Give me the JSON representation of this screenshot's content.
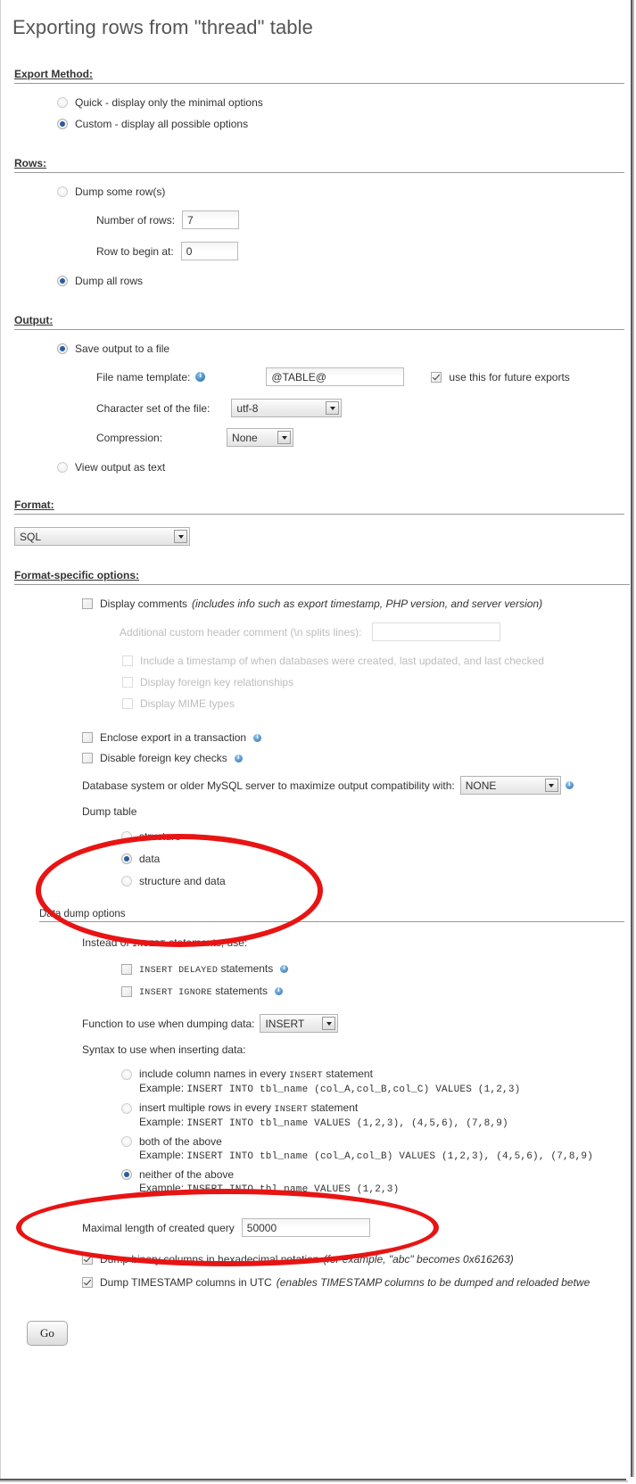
{
  "page_title": "Exporting rows from \"thread\" table",
  "export_method": {
    "legend": "Export Method:",
    "options": [
      {
        "label": "Quick - display only the minimal options",
        "checked": false
      },
      {
        "label": "Custom - display all possible options",
        "checked": true
      }
    ]
  },
  "rows": {
    "legend": "Rows:",
    "dump_some_label": "Dump some row(s)",
    "dump_some_checked": false,
    "number_of_rows_label": "Number of rows:",
    "number_of_rows_value": "7",
    "row_to_begin_label": "Row to begin at:",
    "row_to_begin_value": "0",
    "dump_all_label": "Dump all rows",
    "dump_all_checked": true
  },
  "output": {
    "legend": "Output:",
    "save_to_file_label": "Save output to a file",
    "save_to_file_checked": true,
    "file_name_template_label": "File name template:",
    "file_name_template_value": "@TABLE@",
    "use_future_exports_label": "use this for future exports",
    "use_future_exports_checked": true,
    "charset_label": "Character set of the file:",
    "charset_value": "utf-8",
    "compression_label": "Compression:",
    "compression_value": "None",
    "view_as_text_label": "View output as text",
    "view_as_text_checked": false
  },
  "format": {
    "legend": "Format:",
    "value": "SQL"
  },
  "format_specific": {
    "legend": "Format-specific options:",
    "display_comments_label": "Display comments",
    "display_comments_note": "(includes info such as export timestamp, PHP version, and server version)",
    "display_comments_checked": false,
    "custom_header_label": "Additional custom header comment (\\n splits lines):",
    "custom_header_value": "",
    "sub_options": [
      {
        "label": "Include a timestamp of when databases were created, last updated, and last checked",
        "checked": false
      },
      {
        "label": "Display foreign key relationships",
        "checked": false
      },
      {
        "label": "Display MIME types",
        "checked": false
      }
    ],
    "enclose_transaction_label": "Enclose export in a transaction",
    "enclose_transaction_checked": false,
    "disable_fk_label": "Disable foreign key checks",
    "disable_fk_checked": false,
    "compat_label": "Database system or older MySQL server to maximize output compatibility with:",
    "compat_value": "NONE",
    "dump_table_label": "Dump table",
    "dump_table_options": [
      {
        "label": "structure",
        "checked": false
      },
      {
        "label": "data",
        "checked": true
      },
      {
        "label": "structure and data",
        "checked": false
      }
    ]
  },
  "data_dump": {
    "legend": "Data dump options",
    "instead_of_insert_label_prefix": "Instead of ",
    "instead_of_insert_label_code": "INSERT",
    "instead_of_insert_label_suffix": " statements, use:",
    "insert_delayed_code": "INSERT DELAYED",
    "insert_delayed_suffix": " statements",
    "insert_delayed_checked": false,
    "insert_ignore_code": "INSERT IGNORE",
    "insert_ignore_suffix": " statements",
    "insert_ignore_checked": false,
    "function_label": "Function to use when dumping data:",
    "function_value": "INSERT",
    "syntax_label": "Syntax to use when inserting data:",
    "syntax_options": [
      {
        "label_prefix": "include column names in every ",
        "label_code": "INSERT",
        "label_suffix": " statement",
        "example_prefix": "Example: ",
        "example_code": "INSERT INTO tbl_name (col_A,col_B,col_C) VALUES (1,2,3)",
        "checked": false
      },
      {
        "label_prefix": "insert multiple rows in every ",
        "label_code": "INSERT",
        "label_suffix": " statement",
        "example_prefix": "Example: ",
        "example_code": "INSERT INTO tbl_name VALUES (1,2,3), (4,5,6), (7,8,9)",
        "checked": false
      },
      {
        "label_prefix": "both of the above",
        "label_code": "",
        "label_suffix": "",
        "example_prefix": "Example: ",
        "example_code": "INSERT INTO tbl_name (col_A,col_B) VALUES (1,2,3), (4,5,6), (7,8,9)",
        "checked": false
      },
      {
        "label_prefix": "neither of the above",
        "label_code": "",
        "label_suffix": "",
        "example_prefix": "Example: ",
        "example_code": "INSERT INTO tbl_name VALUES (1,2,3)",
        "checked": true
      }
    ],
    "max_query_label": "Maximal length of created query",
    "max_query_value": "50000",
    "hex_binary_label": "Dump binary columns in hexadecimal notation",
    "hex_binary_note": "(for example, \"abc\" becomes 0x616263)",
    "hex_binary_checked": true,
    "utc_timestamp_label": "Dump TIMESTAMP columns in UTC",
    "utc_timestamp_note": "(enables TIMESTAMP columns to be dumped and reloaded betwe",
    "utc_timestamp_checked": true
  },
  "submit": {
    "go_label": "Go"
  },
  "annotations": {
    "accent_color": "#e81414",
    "marks": [
      {
        "name": "dump-table-highlight"
      },
      {
        "name": "neither-of-the-above-highlight"
      }
    ]
  }
}
